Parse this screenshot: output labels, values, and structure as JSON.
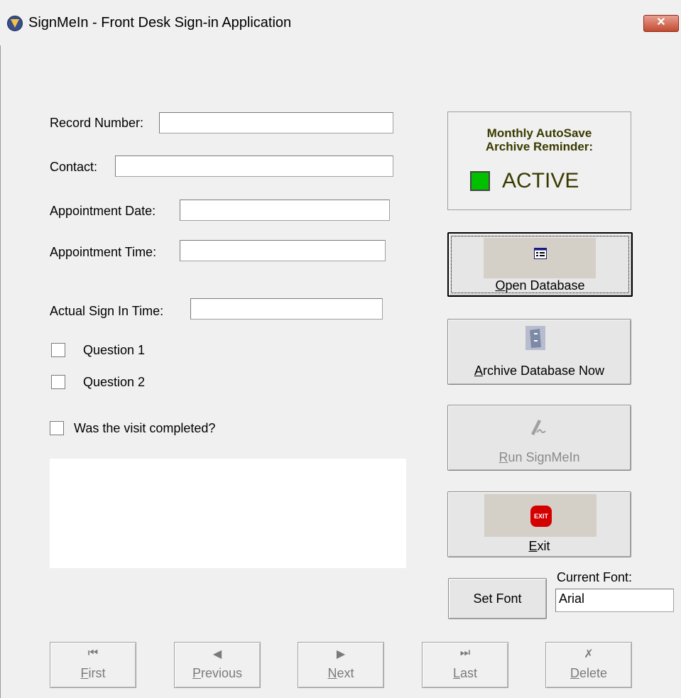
{
  "window": {
    "title": "SignMeIn - Front Desk Sign-in Application",
    "close_symbol": "✕"
  },
  "form": {
    "record_number_label": "Record Number:",
    "contact_label": "Contact:",
    "appointment_date_label": "Appointment Date:",
    "appointment_time_label": "Appointment Time:",
    "actual_sign_in_label": "Actual Sign In Time:",
    "question1_label": "Question 1",
    "question2_label": "Question 2",
    "visit_completed_label": "Was the visit completed?"
  },
  "reminder": {
    "title_line1": "Monthly AutoSave",
    "title_line2": "Archive Reminder:",
    "status": "ACTIVE",
    "status_color": "#00c000"
  },
  "buttons": {
    "open_database": {
      "first": "O",
      "rest": "pen Database",
      "icon": "database-form-icon"
    },
    "archive_database": {
      "first": "A",
      "rest": "rchive Database Now",
      "icon": "filing-cabinet-icon"
    },
    "run_signmein": {
      "first": "R",
      "rest": "un SignMeIn",
      "icon": "signature-pen-icon"
    },
    "exit": {
      "first": "E",
      "rest": "xit",
      "icon": "exit-stop-icon",
      "icon_text": "EXIT"
    }
  },
  "font": {
    "set_font_label": "Set Font",
    "current_font_label": "Current Font:",
    "current_font_value": "Arial"
  },
  "navigation": [
    {
      "first": "F",
      "rest": "irst",
      "glyph": "⏮"
    },
    {
      "first": "P",
      "rest": "revious",
      "glyph": "◀"
    },
    {
      "first": "N",
      "rest": "ext",
      "glyph": "▶"
    },
    {
      "first": "L",
      "rest": "ast",
      "glyph": "⏭"
    },
    {
      "first": "D",
      "rest": "elete",
      "glyph": "✗"
    }
  ]
}
